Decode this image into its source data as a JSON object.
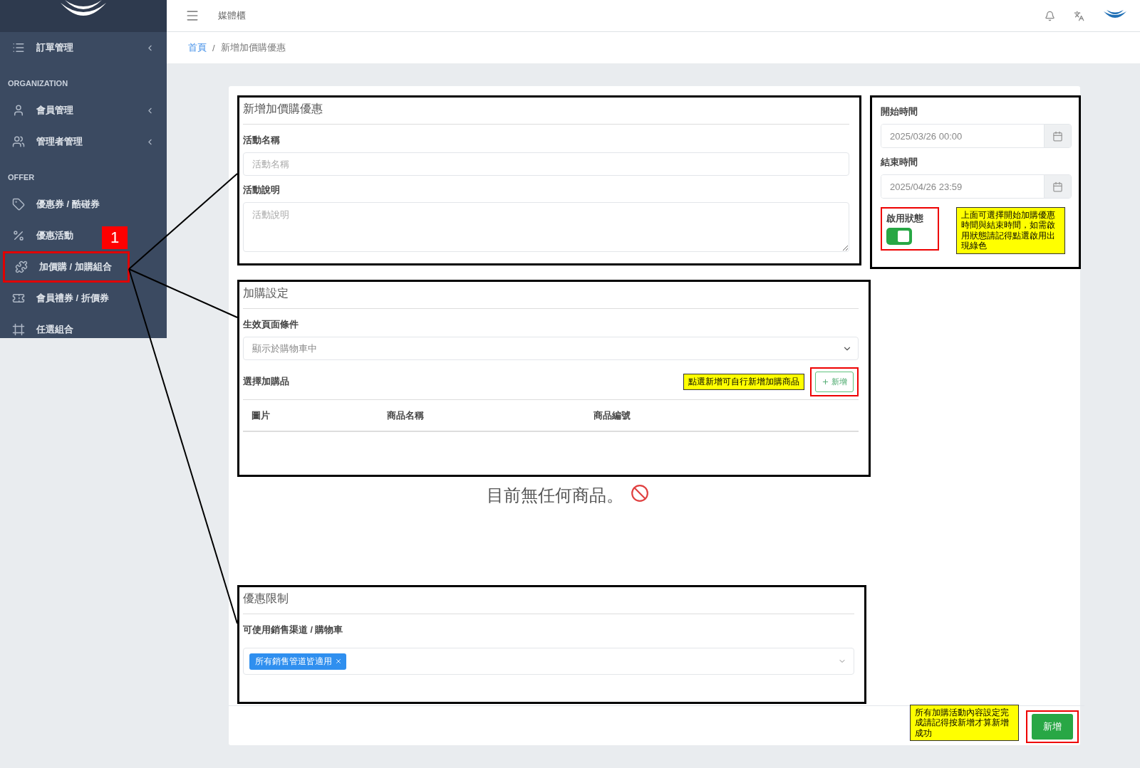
{
  "sidebar": {
    "groups": [
      {
        "items": [
          {
            "label": "訂單管理",
            "caret": true,
            "selected": false
          }
        ]
      },
      {
        "heading": "ORGANIZATION",
        "items": [
          {
            "label": "會員管理",
            "caret": true,
            "selected": false
          },
          {
            "label": "管理者管理",
            "caret": true,
            "selected": false
          }
        ]
      },
      {
        "heading": "OFFER",
        "items": [
          {
            "label": "優惠券 / 酷碰券",
            "caret": false,
            "selected": false
          },
          {
            "label": "優惠活動",
            "caret": false,
            "selected": false,
            "badge": "1"
          },
          {
            "label": "加價購 / 加購組合",
            "caret": false,
            "selected": true
          },
          {
            "label": "會員禮券 / 折價券",
            "caret": false,
            "selected": false
          },
          {
            "label": "任選組合",
            "caret": false,
            "selected": false
          }
        ]
      }
    ]
  },
  "topbar": {
    "title": "媒體櫃"
  },
  "breadcrumb_separator": "/",
  "breadcrumb": [
    {
      "label": "首頁",
      "link": true
    },
    {
      "label": "新增加價購優惠",
      "link": false
    }
  ],
  "form": {
    "title": "新增加價購優惠",
    "fields": [
      {
        "kind": "input",
        "label": "活動名稱",
        "placeholder": "活動名稱"
      },
      {
        "kind": "textarea",
        "label": "活動說明",
        "placeholder": "活動說明"
      }
    ]
  },
  "schedule": {
    "start": {
      "label": "開始時間",
      "value": "2025/03/26 00:00"
    },
    "end": {
      "label": "結束時間",
      "value": "2025/04/26 23:59"
    },
    "status": {
      "label": "啟用狀態",
      "on": true
    },
    "note": "上面可選擇開始加購優惠時間與結束時間，如需啟用狀態請記得點選啟用出現綠色"
  },
  "addon": {
    "title": "加購設定",
    "condition": {
      "label": "生效頁面條件",
      "value": "顯示於購物車中"
    },
    "products": {
      "label": "選擇加購品",
      "note": "點選新增可自行新增加購商品",
      "add_button": "新增",
      "columns": [
        "圖片",
        "商品名稱",
        "商品編號"
      ]
    },
    "empty_message": "目前無任何商品。"
  },
  "limits": {
    "title": "優惠限制",
    "channels": {
      "label": "可使用銷售渠道 / 購物車",
      "tags": [
        "所有銷售管道皆適用"
      ]
    }
  },
  "footer": {
    "note": "所有加購活動內容設定完成請記得按新增才算新增成功",
    "submit": "新增"
  }
}
